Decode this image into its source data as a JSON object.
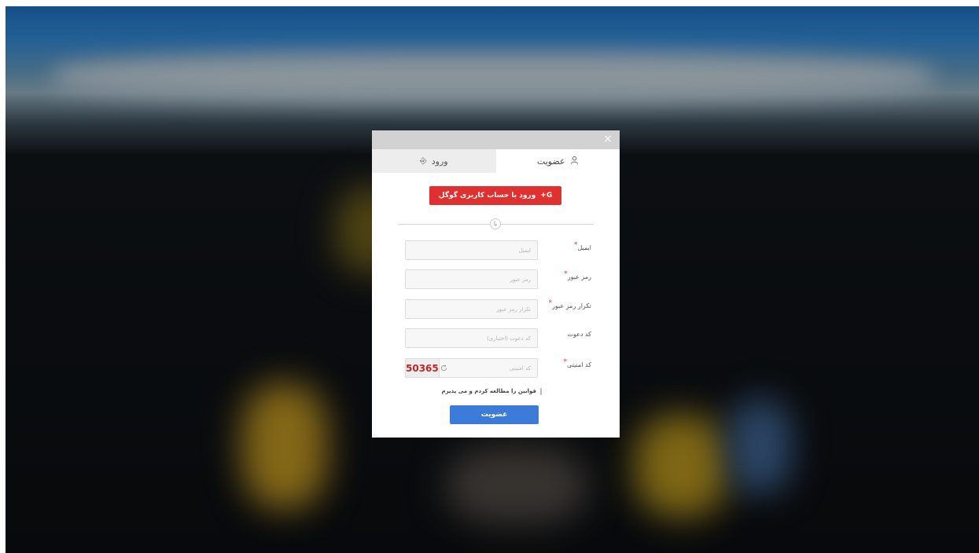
{
  "modal": {
    "close_icon": "×",
    "tabs": [
      {
        "label": "ورود",
        "icon": "login-icon"
      },
      {
        "label": "عضویت",
        "icon": "user-icon"
      }
    ],
    "active_tab": "عضویت",
    "google_button": {
      "label": "ورود با حساب کاربری گوگل",
      "icon": "google-plus-icon"
    },
    "divider_text": "یا",
    "fields": [
      {
        "label": "ایمیل",
        "required": true,
        "placeholder": "ایمیل"
      },
      {
        "label": "رمز عبور",
        "required": true,
        "placeholder": "رمز عبور"
      },
      {
        "label": "تکرار رمز عبور",
        "required": true,
        "placeholder": "تکرار رمز عبور"
      },
      {
        "label": "کد دعوت",
        "required": false,
        "placeholder": "کد دعوت (اختیاری)"
      }
    ],
    "captcha": {
      "label": "کد امنیتی",
      "required": true,
      "placeholder": "کد امنیتی",
      "code": "50365",
      "refresh_icon": "refresh-icon"
    },
    "terms_label": "قوانین را مطالعه کردم و می پذیرم",
    "submit_label": "عضویت",
    "colors": {
      "google_red": "#e03030",
      "submit_blue": "#3d7bd9",
      "required_star": "#e03030"
    }
  }
}
